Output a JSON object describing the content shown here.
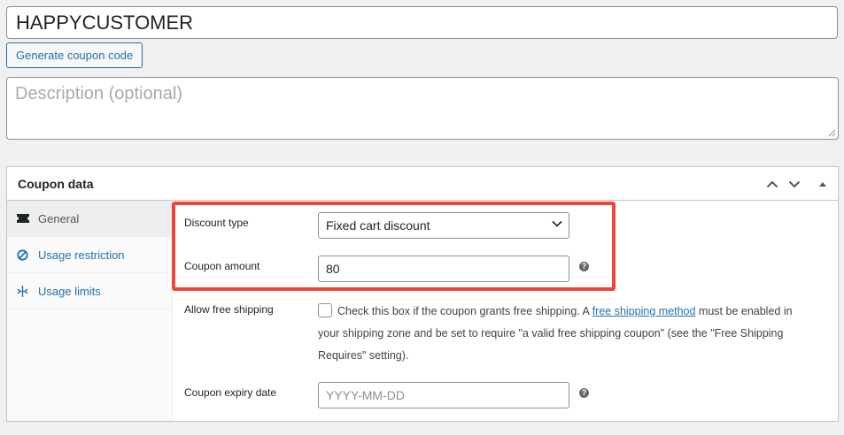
{
  "coupon": {
    "code": "HAPPYCUSTOMER",
    "generate_label": "Generate coupon code",
    "description_placeholder": "Description (optional)"
  },
  "panel": {
    "title": "Coupon data",
    "tabs": [
      {
        "label": "General",
        "icon": "ticket-icon"
      },
      {
        "label": "Usage restriction",
        "icon": "ban-icon"
      },
      {
        "label": "Usage limits",
        "icon": "limits-icon"
      }
    ],
    "fields": {
      "discount_type_label": "Discount type",
      "discount_type_value": "Fixed cart discount",
      "coupon_amount_label": "Coupon amount",
      "coupon_amount_value": "80",
      "free_shipping_label": "Allow free shipping",
      "free_shipping_text_1": "Check this box if the coupon grants free shipping. A",
      "free_shipping_link": "free shipping method",
      "free_shipping_text_2": "must be enabled in your shipping zone and be set to require \"a valid free shipping coupon\" (see the \"Free Shipping Requires\" setting).",
      "expiry_label": "Coupon expiry date",
      "expiry_placeholder": "YYYY-MM-DD",
      "help_glyph": "?"
    }
  },
  "colors": {
    "accent": "#2271b1",
    "highlight": "#ef4638",
    "background": "#f0f0f1"
  }
}
